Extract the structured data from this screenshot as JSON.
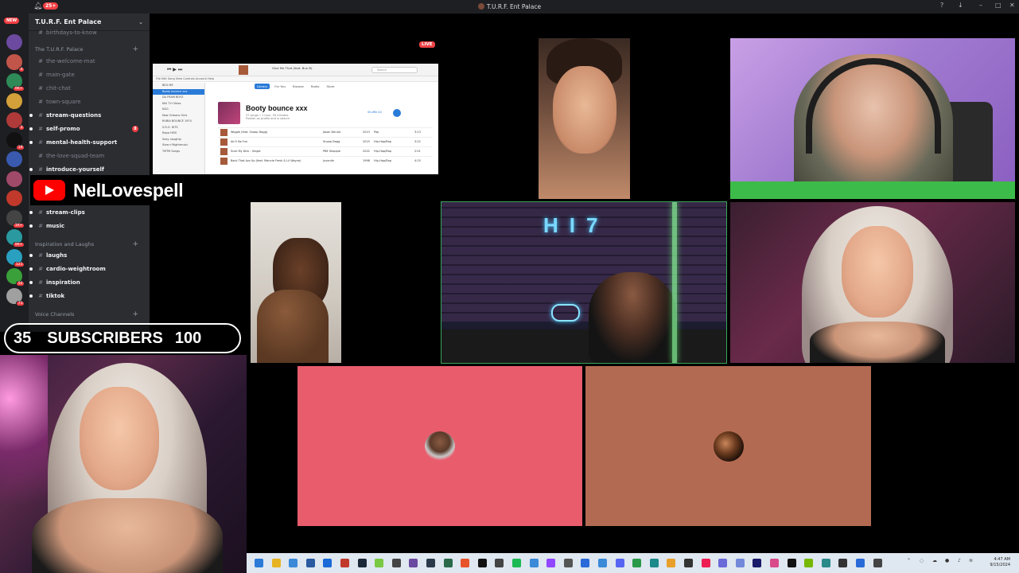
{
  "titlebar": {
    "notif_count": "25+",
    "window_title": "T.U.R.F. Ent Palace"
  },
  "rail": {
    "new_badge": "NEW",
    "servers": [
      {
        "name": "server-1",
        "color": "#6b4aa0",
        "count": ""
      },
      {
        "name": "server-2",
        "color": "#c2554a",
        "count": "4"
      },
      {
        "name": "server-3",
        "color": "#2e8b57",
        "count": "9K+"
      },
      {
        "name": "server-4",
        "color": "#d4a03a",
        "count": ""
      },
      {
        "name": "server-5",
        "color": "#b03a3a",
        "count": "3"
      },
      {
        "name": "server-6",
        "color": "#111111",
        "count": "19"
      },
      {
        "name": "server-7",
        "color": "#3a5ab0",
        "count": ""
      },
      {
        "name": "server-8",
        "color": "#a04a6a",
        "count": ""
      },
      {
        "name": "server-9",
        "color": "#c0392b",
        "count": ""
      },
      {
        "name": "server-10",
        "color": "#444444",
        "count": "1K+"
      },
      {
        "name": "server-11",
        "color": "#2a9aa0",
        "count": "9K+"
      },
      {
        "name": "server-12",
        "color": "#2aa0c0",
        "count": "121"
      },
      {
        "name": "server-13",
        "color": "#3aa03a",
        "count": "50"
      },
      {
        "name": "server-14",
        "color": "#a0a0a0",
        "count": "73"
      }
    ]
  },
  "channels": {
    "server_name": "T.U.R.F. Ent Palace",
    "items_top": [
      {
        "label": "birthdays-to-know",
        "bold": false
      }
    ],
    "category1": "The T.U.R.F. Palace",
    "list1": [
      {
        "label": "the-welcome-mat",
        "bold": false
      },
      {
        "label": "main-gate",
        "bold": false
      },
      {
        "label": "chit-chat",
        "bold": false
      },
      {
        "label": "town-square",
        "bold": false
      },
      {
        "label": "stream-questions",
        "bold": true
      },
      {
        "label": "self-promo",
        "bold": true,
        "ping": "8"
      },
      {
        "label": "mental-health-support",
        "bold": true
      },
      {
        "label": "the-love-squad-team",
        "bold": false
      },
      {
        "label": "introduce-yourself",
        "bold": true
      }
    ],
    "list2": [
      {
        "label": "stream-clips",
        "bold": true
      },
      {
        "label": "music",
        "bold": true
      }
    ],
    "category2": "Inspiration and Laughs",
    "list3": [
      {
        "label": "laughs",
        "bold": true
      },
      {
        "label": "cardio-weightroom",
        "bold": true
      },
      {
        "label": "inspiration",
        "bold": true
      },
      {
        "label": "tiktok",
        "bold": true
      }
    ],
    "category3": "Voice Channels"
  },
  "overlay": {
    "streamer_name": "NelLovespell",
    "subs_current": "35",
    "subs_label": "SUBSCRIBERS",
    "subs_goal": "100"
  },
  "stage": {
    "live_badge": "LIVE",
    "screenshare": {
      "now_playing": "Give Me That (feat. Bun B)",
      "menu": "File  Edit  Song  View  Controls  Account  Help",
      "search_placeholder": "Search",
      "music_label": "Music",
      "sidebar": [
        "BEG ME",
        "Booty bounce xxx",
        "DA FRAM BOYZ",
        "Kiki T.H Vibes",
        "K&G",
        "New Orleans Girls",
        "RUBIA BOUNCE 1974",
        "S.R.O. HITS",
        "Rapa HEIS",
        "Sexy naughty",
        "Slow n'Nightmusic",
        "TMTM Songs"
      ],
      "sidebar_selected": 1,
      "tabs": [
        "Library",
        "For You",
        "Browse",
        "Radio",
        "Store"
      ],
      "tab_active": 0,
      "playlist_title": "Booty bounce xxx",
      "playlist_meta": "37 songs • 1 hour, 59 minutes",
      "publish": "Publish on profile and in search",
      "shuffle": "Shuffle All",
      "rows": [
        {
          "song": "Wiggle (feat. Snoop Dogg)",
          "artist": "Jason Derulo",
          "year": "2013",
          "genre": "Pop",
          "time": "3:13"
        },
        {
          "song": "Ain't No Fun",
          "artist": "Snoop Dogg",
          "year": "2015",
          "genre": "Hip-Hop/Rap",
          "time": "3:22"
        },
        {
          "song": "Suck My Dick - Single",
          "artist": "PBE Shoppie",
          "year": "2022",
          "genre": "Hip-Hop/Rap",
          "time": "2:51"
        },
        {
          "song": "Back That Azz Up (feat. Mannie Fresh & Lil Wayne)",
          "artist": "Juvenile",
          "year": "1998",
          "genre": "Hip-Hop/Rap",
          "time": "4:25"
        }
      ]
    }
  },
  "taskbar": {
    "icons": [
      "#2a7bd8",
      "#e6b422",
      "#3a8ad8",
      "#2a5aa0",
      "#1a6ad8",
      "#c0392b",
      "#1b2838",
      "#7ac943",
      "#444444",
      "#6a4aa0",
      "#2a3a4a",
      "#2a6a4a",
      "#e8542a",
      "#111111",
      "#444444",
      "#1db954",
      "#3a8ad8",
      "#9146ff",
      "#555555",
      "#2a6ad8",
      "#3a8ad8",
      "#5865f2",
      "#2a9a4a",
      "#1a8a8a",
      "#e8a02a",
      "#333333",
      "#ee1d52",
      "#6a6ad8",
      "#7289da",
      "#1a1a6a",
      "#d84a8a",
      "#111111",
      "#76b900",
      "#2a8a8a",
      "#333333",
      "#2a6ad8",
      "#444444"
    ],
    "time": "4:47 AM",
    "date": "9/15/2024",
    "brand_color": "#5865f2"
  }
}
